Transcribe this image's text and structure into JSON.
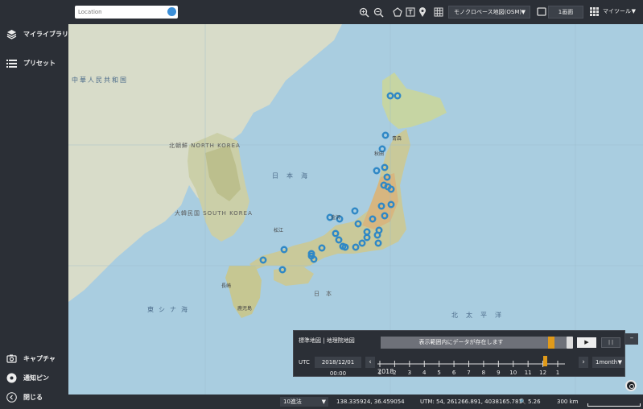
{
  "sidebar": {
    "my_library": "マイライブラリ",
    "presets": "プリセット",
    "capture": "キャプチャ",
    "notify_pin": "通知ピン",
    "close": "閉じる"
  },
  "topbar": {
    "search_placeholder": "Location",
    "basemap": "モノクロベース地図(OSM)",
    "screen": "1画面",
    "my_tools": "マイツール"
  },
  "map": {
    "labels": {
      "china": "中華人民共和国",
      "north_korea": "北朝鮮 NORTH KOREA",
      "south_korea": "大韓民国 SOUTH KOREA",
      "sea_of_japan": "日本海",
      "japan": "日本",
      "east_china_sea": "東シナ海",
      "pacific": "北太平洋",
      "aomori": "青森",
      "akita": "秋田",
      "kanazawa": "金沢",
      "matsue": "松江",
      "nagasaki": "長崎",
      "kagoshima": "鹿児島"
    }
  },
  "timeline": {
    "layers": "標準地図 | 地理院地図",
    "message": "表示範囲内にデータが存在します",
    "play": "▶",
    "pause": "| |",
    "utc": "UTC",
    "date": "2018/12/01 00:00",
    "year": "2018",
    "ticks": [
      "1",
      "2",
      "3",
      "4",
      "5",
      "6",
      "7",
      "8",
      "9",
      "10",
      "11",
      "12",
      "1"
    ],
    "period": "1month"
  },
  "status": {
    "format": "10進法",
    "latlon": "138.335924, 36.459054",
    "utm": "UTM: 54, 261266.891, 4038165.781",
    "zoom": "5.26",
    "scale": "300 km"
  }
}
